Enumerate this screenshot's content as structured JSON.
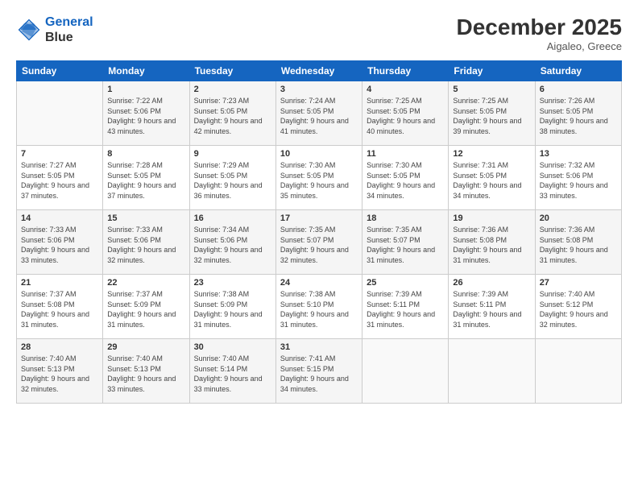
{
  "logo": {
    "line1": "General",
    "line2": "Blue"
  },
  "title": "December 2025",
  "location": "Aigaleo, Greece",
  "weekdays": [
    "Sunday",
    "Monday",
    "Tuesday",
    "Wednesday",
    "Thursday",
    "Friday",
    "Saturday"
  ],
  "weeks": [
    [
      {
        "day": "",
        "sunrise": "",
        "sunset": "",
        "daylight": ""
      },
      {
        "day": "1",
        "sunrise": "Sunrise: 7:22 AM",
        "sunset": "Sunset: 5:06 PM",
        "daylight": "Daylight: 9 hours and 43 minutes."
      },
      {
        "day": "2",
        "sunrise": "Sunrise: 7:23 AM",
        "sunset": "Sunset: 5:05 PM",
        "daylight": "Daylight: 9 hours and 42 minutes."
      },
      {
        "day": "3",
        "sunrise": "Sunrise: 7:24 AM",
        "sunset": "Sunset: 5:05 PM",
        "daylight": "Daylight: 9 hours and 41 minutes."
      },
      {
        "day": "4",
        "sunrise": "Sunrise: 7:25 AM",
        "sunset": "Sunset: 5:05 PM",
        "daylight": "Daylight: 9 hours and 40 minutes."
      },
      {
        "day": "5",
        "sunrise": "Sunrise: 7:25 AM",
        "sunset": "Sunset: 5:05 PM",
        "daylight": "Daylight: 9 hours and 39 minutes."
      },
      {
        "day": "6",
        "sunrise": "Sunrise: 7:26 AM",
        "sunset": "Sunset: 5:05 PM",
        "daylight": "Daylight: 9 hours and 38 minutes."
      }
    ],
    [
      {
        "day": "7",
        "sunrise": "Sunrise: 7:27 AM",
        "sunset": "Sunset: 5:05 PM",
        "daylight": "Daylight: 9 hours and 37 minutes."
      },
      {
        "day": "8",
        "sunrise": "Sunrise: 7:28 AM",
        "sunset": "Sunset: 5:05 PM",
        "daylight": "Daylight: 9 hours and 37 minutes."
      },
      {
        "day": "9",
        "sunrise": "Sunrise: 7:29 AM",
        "sunset": "Sunset: 5:05 PM",
        "daylight": "Daylight: 9 hours and 36 minutes."
      },
      {
        "day": "10",
        "sunrise": "Sunrise: 7:30 AM",
        "sunset": "Sunset: 5:05 PM",
        "daylight": "Daylight: 9 hours and 35 minutes."
      },
      {
        "day": "11",
        "sunrise": "Sunrise: 7:30 AM",
        "sunset": "Sunset: 5:05 PM",
        "daylight": "Daylight: 9 hours and 34 minutes."
      },
      {
        "day": "12",
        "sunrise": "Sunrise: 7:31 AM",
        "sunset": "Sunset: 5:05 PM",
        "daylight": "Daylight: 9 hours and 34 minutes."
      },
      {
        "day": "13",
        "sunrise": "Sunrise: 7:32 AM",
        "sunset": "Sunset: 5:06 PM",
        "daylight": "Daylight: 9 hours and 33 minutes."
      }
    ],
    [
      {
        "day": "14",
        "sunrise": "Sunrise: 7:33 AM",
        "sunset": "Sunset: 5:06 PM",
        "daylight": "Daylight: 9 hours and 33 minutes."
      },
      {
        "day": "15",
        "sunrise": "Sunrise: 7:33 AM",
        "sunset": "Sunset: 5:06 PM",
        "daylight": "Daylight: 9 hours and 32 minutes."
      },
      {
        "day": "16",
        "sunrise": "Sunrise: 7:34 AM",
        "sunset": "Sunset: 5:06 PM",
        "daylight": "Daylight: 9 hours and 32 minutes."
      },
      {
        "day": "17",
        "sunrise": "Sunrise: 7:35 AM",
        "sunset": "Sunset: 5:07 PM",
        "daylight": "Daylight: 9 hours and 32 minutes."
      },
      {
        "day": "18",
        "sunrise": "Sunrise: 7:35 AM",
        "sunset": "Sunset: 5:07 PM",
        "daylight": "Daylight: 9 hours and 31 minutes."
      },
      {
        "day": "19",
        "sunrise": "Sunrise: 7:36 AM",
        "sunset": "Sunset: 5:08 PM",
        "daylight": "Daylight: 9 hours and 31 minutes."
      },
      {
        "day": "20",
        "sunrise": "Sunrise: 7:36 AM",
        "sunset": "Sunset: 5:08 PM",
        "daylight": "Daylight: 9 hours and 31 minutes."
      }
    ],
    [
      {
        "day": "21",
        "sunrise": "Sunrise: 7:37 AM",
        "sunset": "Sunset: 5:08 PM",
        "daylight": "Daylight: 9 hours and 31 minutes."
      },
      {
        "day": "22",
        "sunrise": "Sunrise: 7:37 AM",
        "sunset": "Sunset: 5:09 PM",
        "daylight": "Daylight: 9 hours and 31 minutes."
      },
      {
        "day": "23",
        "sunrise": "Sunrise: 7:38 AM",
        "sunset": "Sunset: 5:09 PM",
        "daylight": "Daylight: 9 hours and 31 minutes."
      },
      {
        "day": "24",
        "sunrise": "Sunrise: 7:38 AM",
        "sunset": "Sunset: 5:10 PM",
        "daylight": "Daylight: 9 hours and 31 minutes."
      },
      {
        "day": "25",
        "sunrise": "Sunrise: 7:39 AM",
        "sunset": "Sunset: 5:11 PM",
        "daylight": "Daylight: 9 hours and 31 minutes."
      },
      {
        "day": "26",
        "sunrise": "Sunrise: 7:39 AM",
        "sunset": "Sunset: 5:11 PM",
        "daylight": "Daylight: 9 hours and 31 minutes."
      },
      {
        "day": "27",
        "sunrise": "Sunrise: 7:40 AM",
        "sunset": "Sunset: 5:12 PM",
        "daylight": "Daylight: 9 hours and 32 minutes."
      }
    ],
    [
      {
        "day": "28",
        "sunrise": "Sunrise: 7:40 AM",
        "sunset": "Sunset: 5:13 PM",
        "daylight": "Daylight: 9 hours and 32 minutes."
      },
      {
        "day": "29",
        "sunrise": "Sunrise: 7:40 AM",
        "sunset": "Sunset: 5:13 PM",
        "daylight": "Daylight: 9 hours and 33 minutes."
      },
      {
        "day": "30",
        "sunrise": "Sunrise: 7:40 AM",
        "sunset": "Sunset: 5:14 PM",
        "daylight": "Daylight: 9 hours and 33 minutes."
      },
      {
        "day": "31",
        "sunrise": "Sunrise: 7:41 AM",
        "sunset": "Sunset: 5:15 PM",
        "daylight": "Daylight: 9 hours and 34 minutes."
      },
      {
        "day": "",
        "sunrise": "",
        "sunset": "",
        "daylight": ""
      },
      {
        "day": "",
        "sunrise": "",
        "sunset": "",
        "daylight": ""
      },
      {
        "day": "",
        "sunrise": "",
        "sunset": "",
        "daylight": ""
      }
    ]
  ]
}
